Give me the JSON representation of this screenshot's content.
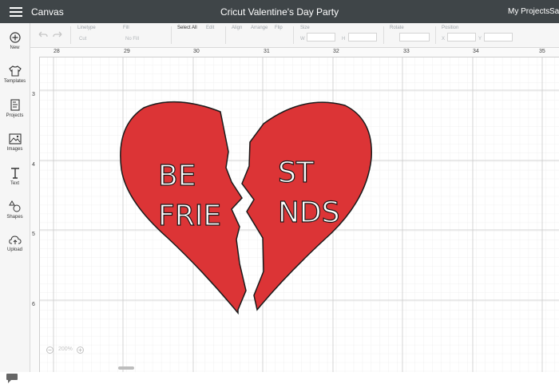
{
  "header": {
    "app_name": "Canvas",
    "document_title": "Cricut Valentine's Day Party",
    "my_projects": "My Projects",
    "save": "Sav"
  },
  "toolbar": {
    "linetype_label": "Linetype",
    "linetype_value": "Cut",
    "fill_label": "Fill",
    "fill_value": "No Fill",
    "select_all": "Select All",
    "edit": "Edit",
    "align": "Align",
    "arrange": "Arrange",
    "flip": "Flip",
    "size": "Size",
    "size_w": "W",
    "size_h": "H",
    "rotate": "Rotate",
    "position": "Position",
    "position_x": "X",
    "position_y": "Y"
  },
  "sidebar": {
    "items": [
      {
        "label": "New",
        "icon": "plus-circle-icon"
      },
      {
        "label": "Templates",
        "icon": "tshirt-icon"
      },
      {
        "label": "Projects",
        "icon": "projects-icon"
      },
      {
        "label": "Images",
        "icon": "image-icon"
      },
      {
        "label": "Text",
        "icon": "text-icon"
      },
      {
        "label": "Shapes",
        "icon": "shapes-icon"
      },
      {
        "label": "Upload",
        "icon": "upload-cloud-icon"
      }
    ]
  },
  "canvas": {
    "ruler_top": [
      "28",
      "29",
      "30",
      "31",
      "32",
      "33",
      "34",
      "35"
    ],
    "ruler_left": [
      "3",
      "4",
      "5",
      "6"
    ],
    "zoom": "200%",
    "heart_color": "#dc3436",
    "heart_left_text": [
      "BE",
      "FRIE"
    ],
    "heart_right_text": [
      "ST",
      "NDS"
    ]
  }
}
